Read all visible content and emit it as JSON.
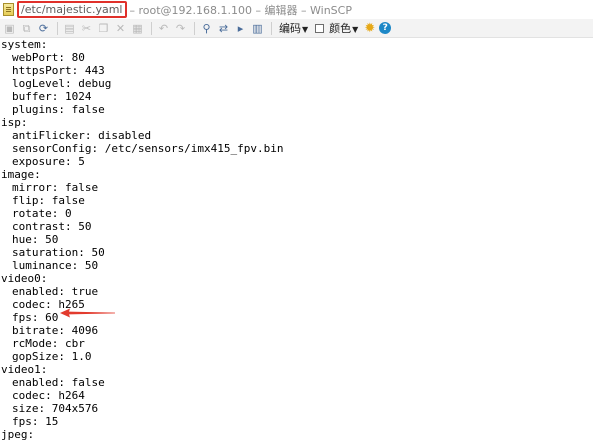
{
  "titlebar": {
    "file_path": "/etc/majestic.yaml",
    "rest": "– root@192.168.1.100 – 编辑器 – WinSCP"
  },
  "toolbar": {
    "encoding_label": "编码",
    "color_label": "颜色"
  },
  "editor": {
    "lines": [
      {
        "text": "system:",
        "indent": 0
      },
      {
        "text": "webPort: 80",
        "indent": 1
      },
      {
        "text": "httpsPort: 443",
        "indent": 1
      },
      {
        "text": "logLevel: debug",
        "indent": 1
      },
      {
        "text": "buffer: 1024",
        "indent": 1
      },
      {
        "text": "plugins: false",
        "indent": 1
      },
      {
        "text": "isp:",
        "indent": 0
      },
      {
        "text": "antiFlicker: disabled",
        "indent": 1
      },
      {
        "text": "sensorConfig: /etc/sensors/imx415_fpv.bin",
        "indent": 1
      },
      {
        "text": "exposure: 5",
        "indent": 1
      },
      {
        "text": "image:",
        "indent": 0
      },
      {
        "text": "mirror: false",
        "indent": 1
      },
      {
        "text": "flip: false",
        "indent": 1
      },
      {
        "text": "rotate: 0",
        "indent": 1
      },
      {
        "text": "contrast: 50",
        "indent": 1
      },
      {
        "text": "hue: 50",
        "indent": 1
      },
      {
        "text": "saturation: 50",
        "indent": 1
      },
      {
        "text": "luminance: 50",
        "indent": 1
      },
      {
        "text": "video0:",
        "indent": 0
      },
      {
        "text": "enabled: true",
        "indent": 1
      },
      {
        "text": "codec: h265",
        "indent": 1
      },
      {
        "text": "fps: 60",
        "indent": 1
      },
      {
        "text": "bitrate: 4096",
        "indent": 1
      },
      {
        "text": "rcMode: cbr",
        "indent": 1
      },
      {
        "text": "gopSize: 1.0",
        "indent": 1
      },
      {
        "text": "video1:",
        "indent": 0
      },
      {
        "text": "enabled: false",
        "indent": 1
      },
      {
        "text": "codec: h264",
        "indent": 1
      },
      {
        "text": "size: 704x576",
        "indent": 1
      },
      {
        "text": "fps: 15",
        "indent": 1
      },
      {
        "text": "jpeg:",
        "indent": 0
      }
    ]
  },
  "annotation": {
    "arrow_color": "#e23b2e"
  }
}
